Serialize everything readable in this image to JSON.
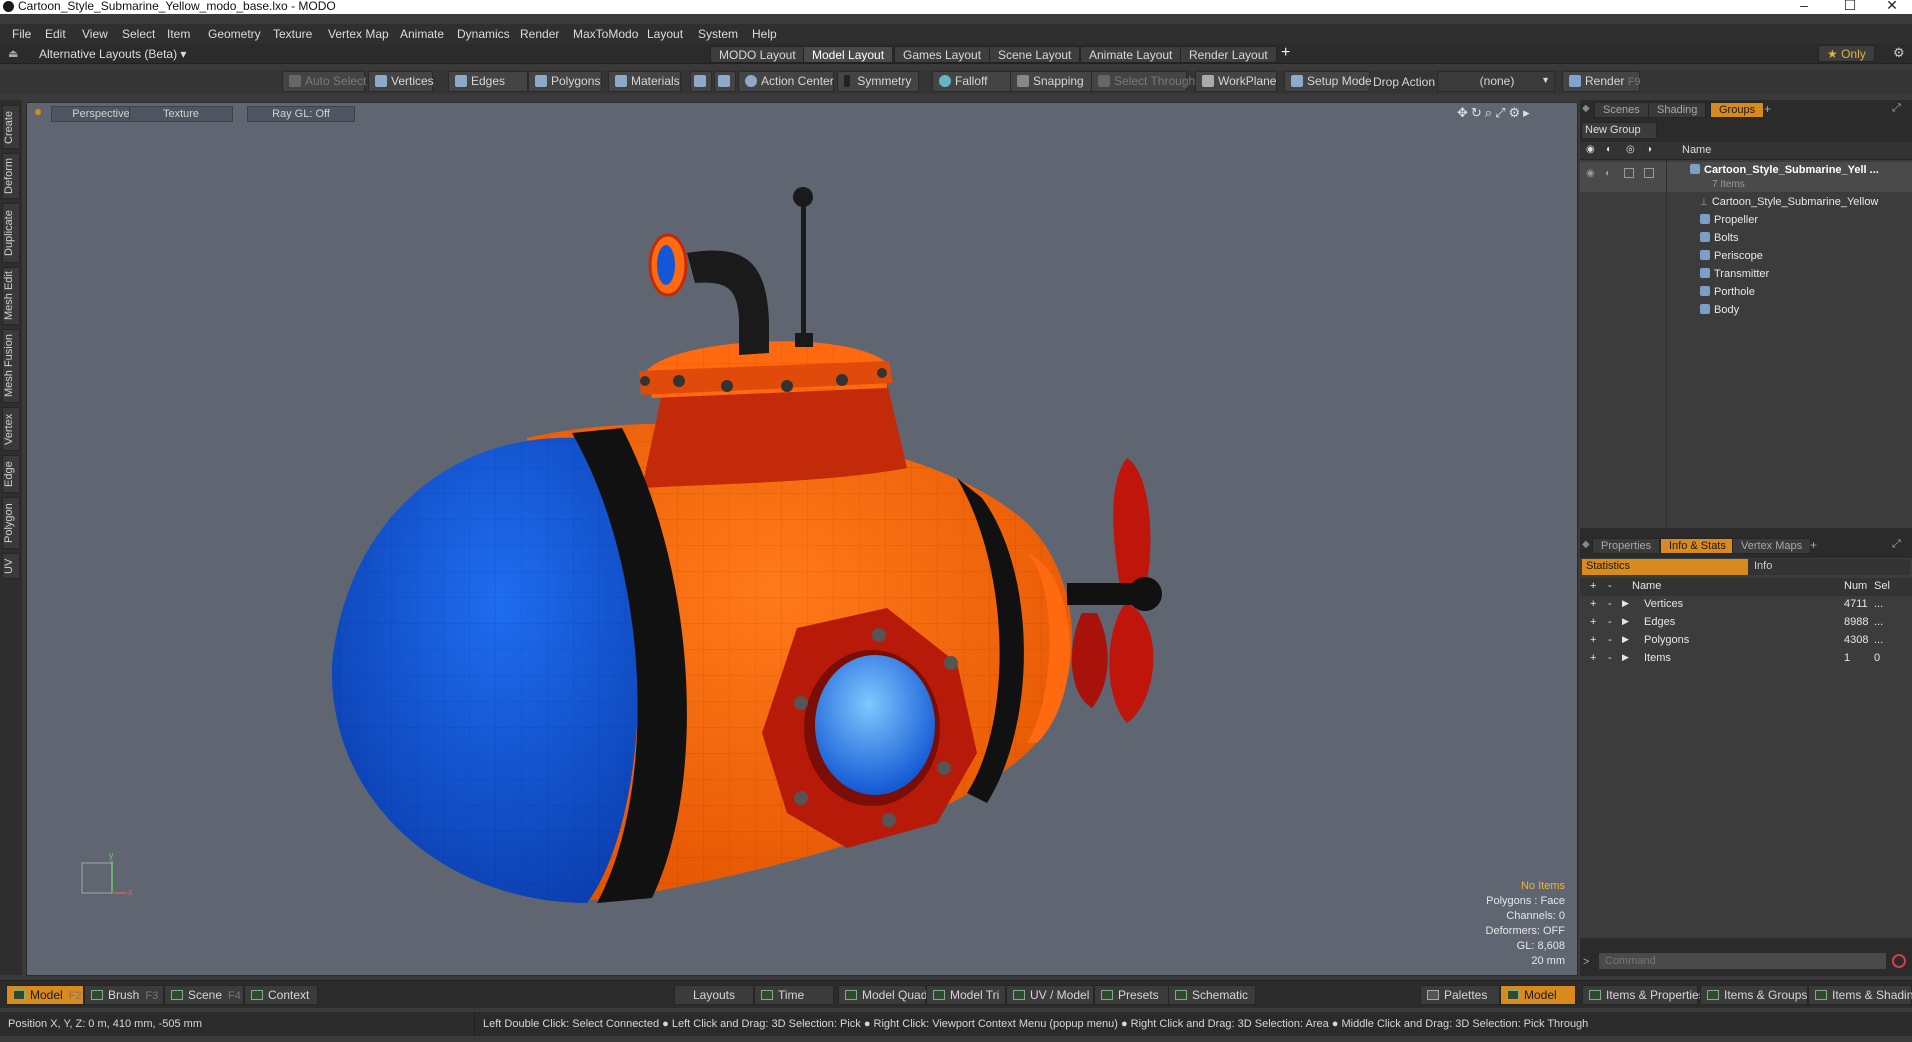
{
  "window": {
    "title": "Cartoon_Style_Submarine_Yellow_modo_base.lxo - MODO",
    "controls": {
      "minimize": "–",
      "maximize": "☐",
      "close": "✕"
    }
  },
  "menu": [
    "File",
    "Edit",
    "View",
    "Select",
    "Item",
    "Geometry",
    "Texture",
    "Vertex Map",
    "Animate",
    "Dynamics",
    "Render",
    "MaxToModo",
    "Layout",
    "System",
    "Help"
  ],
  "layout_bar": {
    "alt_layouts": "Alternative Layouts (Beta) ▾",
    "tabs": [
      "MODO Layout",
      "Model Layout",
      "Games Layout",
      "Scene Layout",
      "Animate Layout",
      "Render Layout"
    ],
    "active_tab": "Model Layout",
    "add": "+",
    "only": "★ Only"
  },
  "toolbar": {
    "auto_select": "Auto Select",
    "vertices": "Vertices",
    "edges": "Edges",
    "polygons": "Polygons",
    "materials": "Materials",
    "action_center": "Action Center",
    "symmetry": "Symmetry",
    "falloff": "Falloff",
    "snapping": "Snapping",
    "select_through": "Select Through",
    "workplane": "WorkPlane",
    "setup_mode": "Setup Mode",
    "drop_action_label": "Drop Action",
    "drop_action_value": "(none)",
    "render": "Render",
    "render_key": "F9"
  },
  "left_tabs": [
    "Create",
    "Deform",
    "Duplicate",
    "Mesh Edit",
    "Mesh Fusion",
    "Vertex",
    "Edge",
    "Polygon",
    "UV"
  ],
  "viewport": {
    "view": "Perspective",
    "shading": "Texture",
    "raygl": "Ray GL: Off",
    "info": {
      "items": "No Items",
      "polygons": "Polygons : Face",
      "channels": "Channels: 0",
      "deformers": "Deformers: OFF",
      "gl": "GL: 8,608",
      "scale": "20 mm"
    }
  },
  "scene_panel": {
    "tabs": [
      "Scenes",
      "Shading",
      "Groups"
    ],
    "active_tab": "Groups",
    "new_group": "New Group",
    "name_header": "Name",
    "group_name": "Cartoon_Style_Submarine_Yell ...",
    "group_count": "7 Items",
    "items": [
      "Cartoon_Style_Submarine_Yellow",
      "Propeller",
      "Bolts",
      "Periscope",
      "Transmitter",
      "Porthole",
      "Body"
    ]
  },
  "stats_panel": {
    "tabs": [
      "Properties",
      "Info & Stats",
      "Vertex Maps"
    ],
    "active_tab": "Info & Stats",
    "subtabs": [
      "Statistics",
      "Info"
    ],
    "headers": {
      "name": "Name",
      "num": "Num",
      "sel": "Sel"
    },
    "rows": [
      {
        "name": "Vertices",
        "num": "4711",
        "sel": "..."
      },
      {
        "name": "Edges",
        "num": "8988",
        "sel": "..."
      },
      {
        "name": "Polygons",
        "num": "4308",
        "sel": "..."
      },
      {
        "name": "Items",
        "num": "1",
        "sel": "0"
      }
    ],
    "command_placeholder": "Command"
  },
  "bottom_bar": {
    "model": "Model",
    "model_key": "F2",
    "brush": "Brush",
    "brush_key": "F3",
    "scene": "Scene",
    "scene_key": "F4",
    "context": "Context",
    "layouts": "Layouts",
    "time": "Time",
    "model_quad": "Model Quad",
    "model_tri": "Model Tri",
    "uv_model": "UV / Model",
    "presets": "Presets",
    "schematic": "Schematic",
    "palettes": "Palettes",
    "model_right": "Model",
    "items_properties": "Items & Properties",
    "items_groups": "Items & Groups",
    "items_shading": "Items & Shading"
  },
  "status": {
    "position": "Position X, Y, Z:   0 m, 410 mm, -505 mm",
    "hints": "Left Double Click: Select Connected ● Left Click and Drag: 3D Selection: Pick ● Right Click: Viewport Context Menu (popup menu) ● Right Click and Drag: 3D Selection: Area ● Middle Click and Drag: 3D Selection: Pick Through"
  }
}
